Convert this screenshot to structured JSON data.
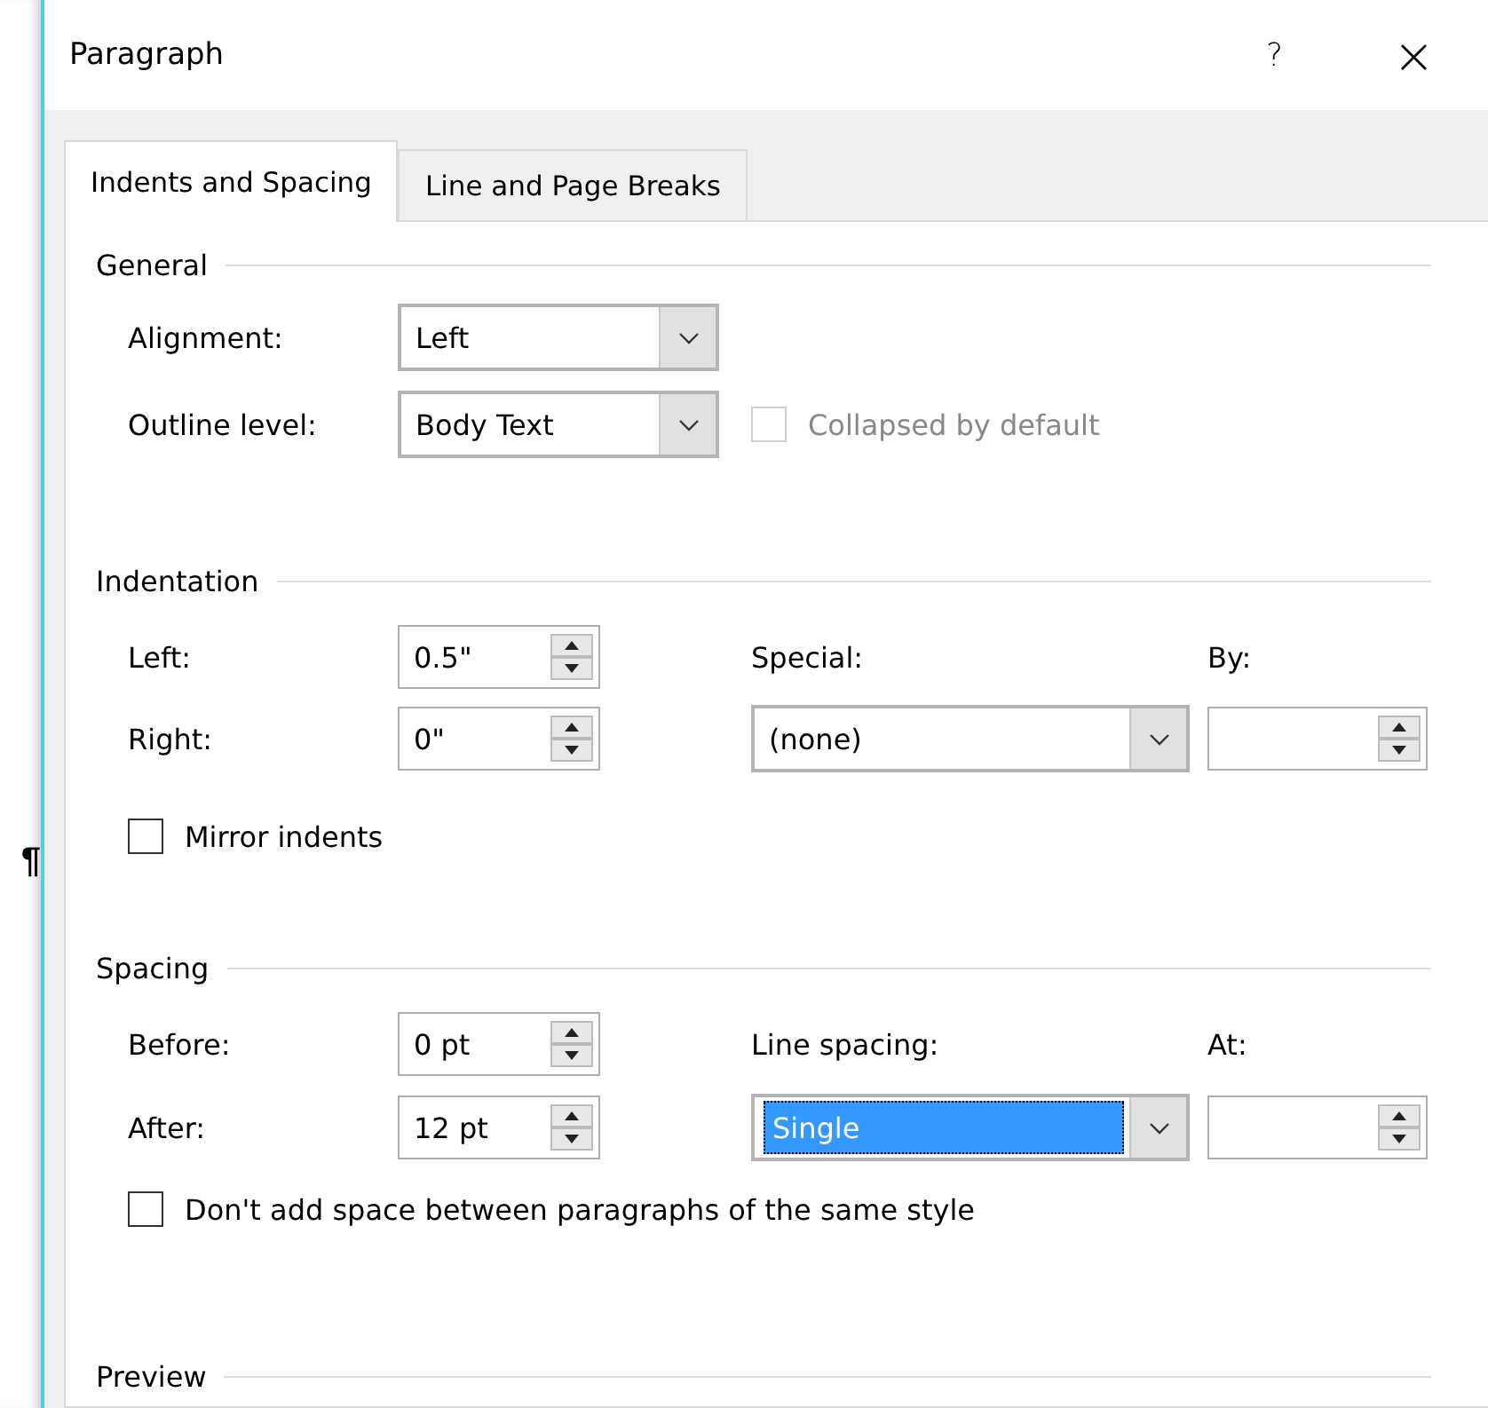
{
  "window": {
    "title": "Paragraph",
    "help_button": "?",
    "close_button": "×"
  },
  "background_document": {
    "text": "¶"
  },
  "tabs": [
    {
      "label": "Indents and Spacing",
      "selected": true
    },
    {
      "label": "Line and Page Breaks",
      "selected": false
    }
  ],
  "general": {
    "title": "General",
    "alignment": {
      "label": "Alignment:",
      "value": "Left"
    },
    "outline_level": {
      "label": "Outline level:",
      "value": "Body Text"
    },
    "collapsed": {
      "label": "Collapsed by default",
      "checked": false,
      "disabled": true
    }
  },
  "indentation": {
    "title": "Indentation",
    "left": {
      "label": "Left:",
      "value": "0.5\""
    },
    "right": {
      "label": "Right:",
      "value": "0\""
    },
    "special": {
      "label": "Special:",
      "value": "(none)"
    },
    "by": {
      "label": "By:"
    },
    "mirror": {
      "label": "Mirror indents",
      "checked": false
    }
  },
  "spacing": {
    "title": "Spacing",
    "before": {
      "label": "Before:",
      "value": "0 pt"
    },
    "after": {
      "label": "After:",
      "value": "12 pt"
    },
    "line_spacing": {
      "label": "Line spacing:",
      "value": "Single",
      "highlighted": true
    },
    "at": {
      "label": "At:"
    },
    "dont_add": {
      "label": "Don't add space between paragraphs of the same style",
      "checked": false
    }
  },
  "preview": {
    "title": "Preview"
  }
}
